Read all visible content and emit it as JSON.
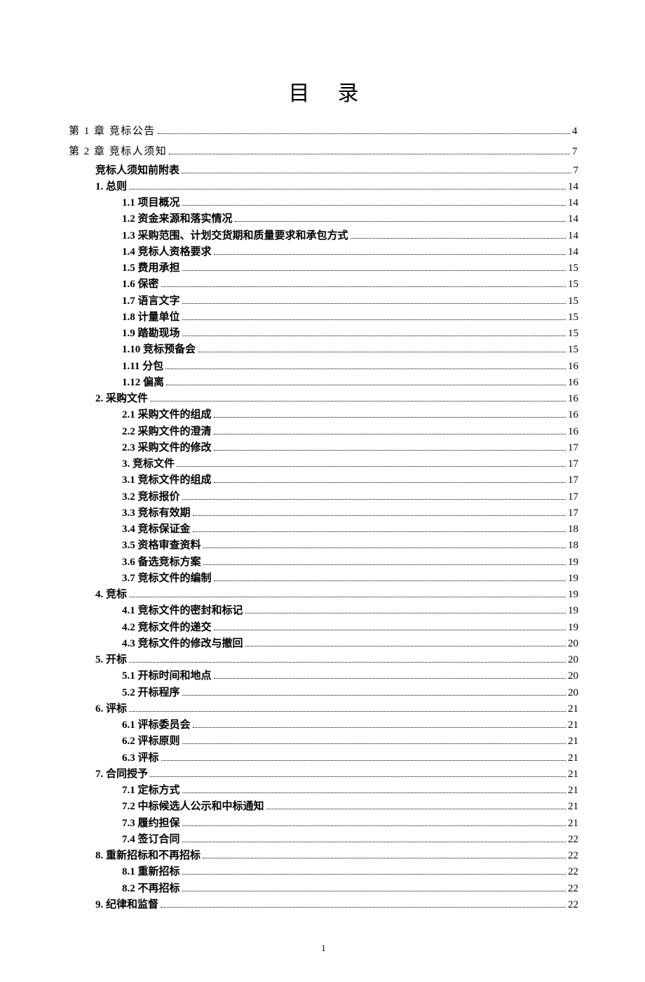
{
  "title": "目录",
  "page_number": "1",
  "toc": [
    {
      "lvl": 0,
      "label": "第 1 章  竞标公告",
      "page": "4",
      "chapter": true
    },
    {
      "lvl": 0,
      "label": "第 2 章  竞标人须知",
      "page": "7",
      "chapter": true
    },
    {
      "lvl": 1,
      "label": "竞标人须知前附表",
      "page": "7"
    },
    {
      "lvl": 1,
      "label": "1. 总则",
      "page": "14"
    },
    {
      "lvl": 2,
      "label": "1.1 项目概况",
      "page": "14"
    },
    {
      "lvl": 2,
      "label": "1.2 资金来源和落实情况",
      "page": "14"
    },
    {
      "lvl": 2,
      "label": "1.3 采购范围、计划交货期和质量要求和承包方式",
      "page": "14"
    },
    {
      "lvl": 2,
      "label": "1.4 竞标人资格要求",
      "page": "14"
    },
    {
      "lvl": 2,
      "label": "1.5 费用承担",
      "page": "15"
    },
    {
      "lvl": 2,
      "label": "1.6 保密",
      "page": "15"
    },
    {
      "lvl": 2,
      "label": "1.7 语言文字",
      "page": "15"
    },
    {
      "lvl": 2,
      "label": "1.8 计量单位",
      "page": "15"
    },
    {
      "lvl": 2,
      "label": "1.9 踏勘现场",
      "page": "15"
    },
    {
      "lvl": 2,
      "label": "1.10 竞标预备会",
      "page": "15"
    },
    {
      "lvl": 2,
      "label": "1.11 分包",
      "page": "16"
    },
    {
      "lvl": 2,
      "label": "1.12 偏离",
      "page": "16"
    },
    {
      "lvl": 1,
      "label": "2. 采购文件",
      "page": "16"
    },
    {
      "lvl": 2,
      "label": "2.1 采购文件的组成",
      "page": "16"
    },
    {
      "lvl": 2,
      "label": "2.2 采购文件的澄清",
      "page": "16"
    },
    {
      "lvl": 2,
      "label": "2.3 采购文件的修改",
      "page": "17"
    },
    {
      "lvl": 2,
      "label": "3. 竞标文件",
      "page": "17"
    },
    {
      "lvl": 2,
      "label": "3.1 竞标文件的组成",
      "page": "17"
    },
    {
      "lvl": 2,
      "label": "3.2 竞标报价",
      "page": "17"
    },
    {
      "lvl": 2,
      "label": "3.3 竞标有效期",
      "page": "17"
    },
    {
      "lvl": 2,
      "label": "3.4 竞标保证金",
      "page": "18"
    },
    {
      "lvl": 2,
      "label": "3.5 资格审查资料",
      "page": "18"
    },
    {
      "lvl": 2,
      "label": "3.6 备选竞标方案",
      "page": "19"
    },
    {
      "lvl": 2,
      "label": "3.7 竞标文件的编制",
      "page": "19"
    },
    {
      "lvl": 1,
      "label": "4. 竞标",
      "page": "19"
    },
    {
      "lvl": 2,
      "label": "4.1 竞标文件的密封和标记",
      "page": "19"
    },
    {
      "lvl": 2,
      "label": "4.2 竞标文件的递交",
      "page": "19"
    },
    {
      "lvl": 2,
      "label": "4.3 竞标文件的修改与撤回",
      "page": "20"
    },
    {
      "lvl": 1,
      "label": "5. 开标",
      "page": "20"
    },
    {
      "lvl": 2,
      "label": "5.1 开标时间和地点",
      "page": "20"
    },
    {
      "lvl": 2,
      "label": "5.2 开标程序",
      "page": "20"
    },
    {
      "lvl": 1,
      "label": "6. 评标",
      "page": "21"
    },
    {
      "lvl": 2,
      "label": "6.1 评标委员会",
      "page": "21"
    },
    {
      "lvl": 2,
      "label": "6.2 评标原则",
      "page": "21"
    },
    {
      "lvl": 2,
      "label": "6.3 评标",
      "page": "21"
    },
    {
      "lvl": 1,
      "label": "7. 合同授予",
      "page": "21"
    },
    {
      "lvl": 2,
      "label": "7.1 定标方式",
      "page": "21"
    },
    {
      "lvl": 2,
      "label": "7.2 中标候选人公示和中标通知",
      "page": "21"
    },
    {
      "lvl": 2,
      "label": "7.3 履约担保",
      "page": "21"
    },
    {
      "lvl": 2,
      "label": "7.4 签订合同",
      "page": "22"
    },
    {
      "lvl": 1,
      "label": "8. 重新招标和不再招标",
      "page": "22"
    },
    {
      "lvl": 2,
      "label": "8.1 重新招标",
      "page": "22"
    },
    {
      "lvl": 2,
      "label": "8.2 不再招标",
      "page": "22"
    },
    {
      "lvl": 1,
      "label": "9. 纪律和监督",
      "page": "22"
    }
  ]
}
